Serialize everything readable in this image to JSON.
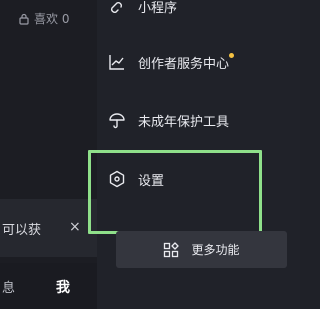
{
  "profile": {
    "likes_label": "喜欢 0"
  },
  "toast": {
    "text": "可以获",
    "close_glyph": "×"
  },
  "bottom_nav": {
    "messages_label": "息",
    "me_label": "我"
  },
  "drawer": {
    "items": [
      {
        "label": "小程序",
        "icon": "mini-program-icon"
      },
      {
        "label": "创作者服务中心",
        "icon": "trend-chart-icon",
        "has_dot": true
      },
      {
        "label": "未成年保护工具",
        "icon": "umbrella-icon"
      },
      {
        "label": "设置",
        "icon": "settings-hexagon-icon"
      }
    ],
    "more_button_label": "更多功能"
  },
  "colors": {
    "drawer_bg": "#202229",
    "highlight": "#8fe08a",
    "notification_dot": "#f5c242"
  }
}
